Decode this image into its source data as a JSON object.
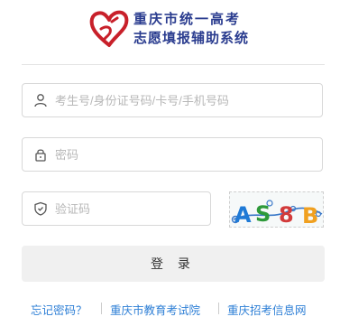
{
  "header": {
    "title_line1": "重庆市统一高考",
    "title_line2": "志愿填报辅助系统"
  },
  "form": {
    "account_placeholder": "考生号/身份证号码/卡号/手机号码",
    "password_placeholder": "密码",
    "captcha_placeholder": "验证码",
    "captcha_chars": [
      "A",
      "S",
      "8",
      "B"
    ],
    "captcha_colors": [
      "#1f7ad6",
      "#2e9a3a",
      "#d23b3b",
      "#f0a020"
    ],
    "login_label": "登 录"
  },
  "footer": {
    "links": [
      {
        "label": "忘记密码？"
      },
      {
        "label": "重庆市教育考试院"
      },
      {
        "label": "重庆招考信息网"
      }
    ]
  },
  "icons": {
    "account": "user-icon",
    "password": "lock-icon",
    "captcha": "shield-icon",
    "logo": "heart-logo"
  },
  "colors": {
    "title": "#2a3c8f",
    "logo": "#c8202a",
    "link": "#2e7fd6"
  }
}
